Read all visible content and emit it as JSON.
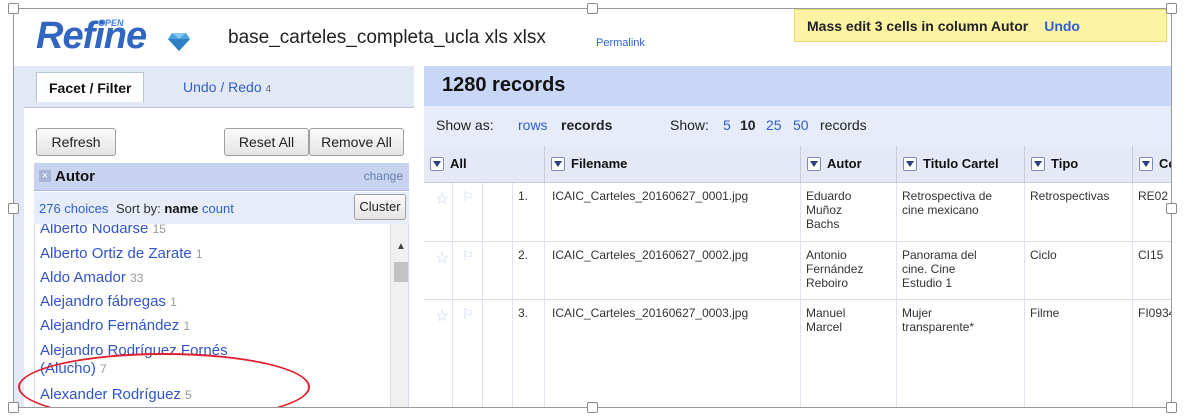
{
  "header": {
    "logo_text": "Refine",
    "logo_super": "OPEN",
    "project_name": "base_carteles_completa_ucla xls xlsx",
    "permalink": "Permalink"
  },
  "notification": {
    "message": "Mass edit 3 cells in column Autor",
    "undo": "Undo"
  },
  "left_panel": {
    "tabs": [
      {
        "label": "Facet / Filter"
      },
      {
        "label": "Undo / Redo",
        "count": "4"
      }
    ],
    "buttons": {
      "refresh": "Refresh",
      "reset_all": "Reset All",
      "remove_all": "Remove All"
    },
    "facet": {
      "title": "Autor",
      "change": "change",
      "choices": "276 choices",
      "sort_by": "Sort by:",
      "sort_name": "name",
      "sort_count": "count",
      "cluster": "Cluster",
      "items": [
        {
          "name": "Alberto Nodarse",
          "count": "15"
        },
        {
          "name": "Alberto Ortiz de Zarate",
          "count": "1"
        },
        {
          "name": "Aldo Amador",
          "count": "33"
        },
        {
          "name": "Alejandro fábregas",
          "count": "1"
        },
        {
          "name": "Alejandro Fernández",
          "count": "1"
        },
        {
          "name": "Alejandro Rodríguez Fornés",
          "name2": "(Alucho)",
          "count": "7"
        },
        {
          "name": "Alexander Rodríguez",
          "count": "5"
        }
      ]
    }
  },
  "main": {
    "records_title": "1280 records",
    "show_as": "Show as:",
    "rows": "rows",
    "records": "records",
    "show": "Show:",
    "page_sizes": [
      "5",
      "10",
      "25",
      "50"
    ],
    "records_suffix": "records",
    "columns": [
      "All",
      "Filename",
      "Autor",
      "Titulo Cartel",
      "Tipo",
      "Co"
    ],
    "rows_data": [
      {
        "n": "1.",
        "filename": "ICAIC_Carteles_20160627_0001.jpg",
        "autor": [
          "Eduardo",
          "Muñoz",
          "Bachs"
        ],
        "titulo": [
          "Retrospectiva de",
          "cine mexicano"
        ],
        "tipo": "Retrospectivas",
        "co": "RE02"
      },
      {
        "n": "2.",
        "filename": "ICAIC_Carteles_20160627_0002.jpg",
        "autor": [
          "Antonio",
          "Fernández",
          "Reboiro"
        ],
        "titulo": [
          "Panorama del",
          "cine. Cine",
          "Estudio 1"
        ],
        "tipo": "Ciclo",
        "co": "CI15"
      },
      {
        "n": "3.",
        "filename": "ICAIC_Carteles_20160627_0003.jpg",
        "autor": [
          "Manuel",
          "Marcel"
        ],
        "titulo": [
          "Mujer",
          "transparente*"
        ],
        "tipo": "Filme",
        "co": "FI0934"
      }
    ]
  },
  "colors": {
    "accent": "#3065c0",
    "link": "#2f5fcf",
    "highlight_ellipse": "#e0202e",
    "notification_bg": "#fdf4a3"
  }
}
